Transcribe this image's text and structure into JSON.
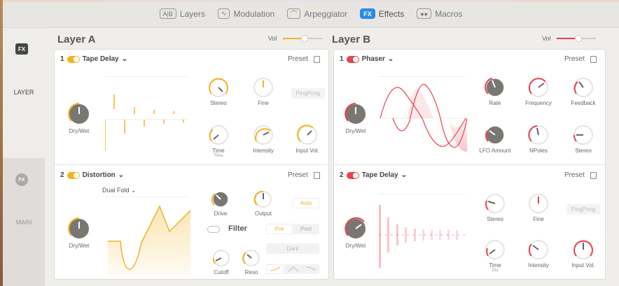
{
  "tabs": [
    {
      "icon": "A|B",
      "label": "Layers",
      "active": false
    },
    {
      "icon": "∿",
      "label": "Modulation",
      "active": false
    },
    {
      "icon": "⌒",
      "label": "Arpeggiator",
      "active": false
    },
    {
      "icon": "FX",
      "label": "Effects",
      "active": true
    },
    {
      "icon": "●●",
      "label": "Macros",
      "active": false
    }
  ],
  "sidebar": {
    "fx_label": "FX",
    "layer_label": "LAYER",
    "main_fx": "FX",
    "main_label": "MAIN"
  },
  "layerA": {
    "title": "Layer A",
    "vol_label": "Vol",
    "vol_level": 0.55,
    "accent": "#f2b321",
    "slot1": {
      "num": "1",
      "name": "Tape Delay",
      "preset": "Preset",
      "knobs": {
        "drywet": "Dry/Wet",
        "stereo": "Stereo",
        "fine": "Fine",
        "time": "Time",
        "time_sub": "Time",
        "intensity": "Intensity",
        "input": "Input Vol."
      },
      "button": "PingPong"
    },
    "slot2": {
      "num": "2",
      "name": "Distortion",
      "preset": "Preset",
      "mode": "Dual Fold",
      "knobs": {
        "drywet": "Dry/Wet",
        "drive": "Drive",
        "output": "Output",
        "cutoff": "Cutoff",
        "reso": "Reso"
      },
      "auto": "Auto",
      "filter": "Filter",
      "pre": "Pre",
      "post": "Post",
      "dark": "Dark"
    }
  },
  "layerB": {
    "title": "Layer B",
    "vol_label": "Vol",
    "vol_level": 0.55,
    "accent": "#e8414f",
    "slot1": {
      "num": "1",
      "name": "Phaser",
      "preset": "Preset",
      "knobs": {
        "drywet": "Dry/Wet",
        "rate": "Rate",
        "frequency": "Frequency",
        "feedback": "Feedback",
        "lfo": "LFO Amount",
        "npoles": "NPoles",
        "stereo": "Stereo"
      }
    },
    "slot2": {
      "num": "2",
      "name": "Tape Delay",
      "preset": "Preset",
      "knobs": {
        "drywet": "Dry/Wet",
        "stereo": "Stereo",
        "fine": "Fine",
        "time": "Time",
        "time_sub": "Div",
        "intensity": "Intensity",
        "input": "Input Vol."
      },
      "button": "PingPong"
    }
  }
}
